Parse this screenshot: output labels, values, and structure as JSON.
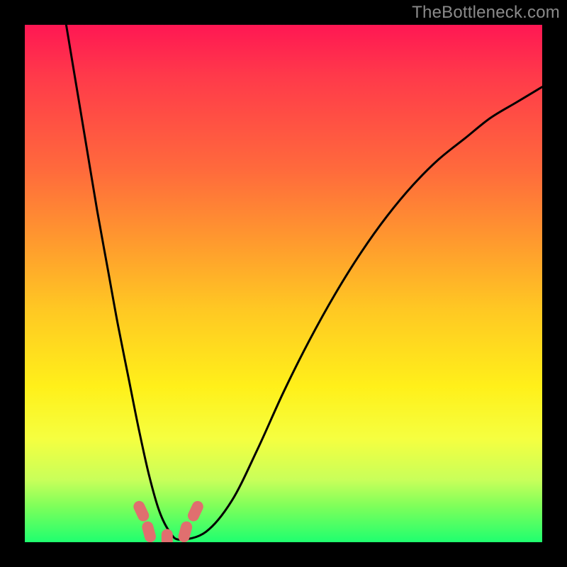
{
  "watermark": "TheBottleneck.com",
  "chart_data": {
    "type": "line",
    "title": "",
    "xlabel": "",
    "ylabel": "",
    "xlim": [
      0,
      100
    ],
    "ylim": [
      0,
      100
    ],
    "grid": false,
    "legend": false,
    "series": [
      {
        "name": "bottleneck-curve",
        "x": [
          8,
          10,
          12,
          14,
          16,
          18,
          20,
          22,
          24,
          26,
          28,
          30,
          35,
          40,
          45,
          50,
          55,
          60,
          65,
          70,
          75,
          80,
          85,
          90,
          95,
          100
        ],
        "y": [
          100,
          88,
          76,
          64,
          53,
          42,
          32,
          22,
          13,
          6,
          2,
          0.5,
          2,
          8,
          18,
          29,
          39,
          48,
          56,
          63,
          69,
          74,
          78,
          82,
          85,
          88
        ]
      }
    ],
    "markers": [
      {
        "name": "marker-left-1",
        "x": 22.5,
        "y": 6
      },
      {
        "name": "marker-left-2",
        "x": 24.0,
        "y": 2
      },
      {
        "name": "marker-bottom",
        "x": 27.5,
        "y": 0.5
      },
      {
        "name": "marker-right-1",
        "x": 31.0,
        "y": 2
      },
      {
        "name": "marker-right-2",
        "x": 33.0,
        "y": 6
      }
    ],
    "marker_color": "#e06f6f",
    "curve_color": "#000000"
  }
}
